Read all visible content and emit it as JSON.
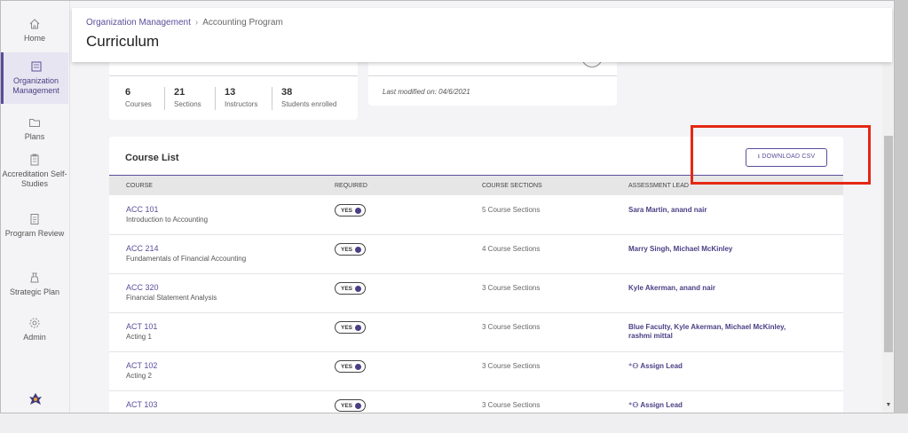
{
  "sidebar": {
    "items": [
      {
        "label": "Home",
        "icon": "home-icon"
      },
      {
        "label": "Organization Management",
        "icon": "organization-icon"
      },
      {
        "label": "Plans",
        "icon": "folder-icon"
      },
      {
        "label": "Accreditation Self-Studies",
        "icon": "clipboard-icon"
      },
      {
        "label": "Program Review",
        "icon": "document-icon"
      },
      {
        "label": "Strategic Plan",
        "icon": "chess-icon"
      },
      {
        "label": "Admin",
        "icon": "gear-icon"
      }
    ],
    "active": "Organization Management"
  },
  "header": {
    "breadcrumb": [
      "Organization Management",
      "Accounting Program"
    ],
    "title": "Curriculum"
  },
  "stats": [
    {
      "value": "6",
      "label": "Courses"
    },
    {
      "value": "21",
      "label": "Sections"
    },
    {
      "value": "13",
      "label": "Instructors"
    },
    {
      "value": "38",
      "label": "Students enrolled"
    }
  ],
  "modified": {
    "text": "Last modified on: 04/6/2021"
  },
  "course_list": {
    "title": "Course List",
    "download_label": "DOWNLOAD CSV",
    "columns": [
      "COURSE",
      "REQUIRED",
      "COURSE SECTIONS",
      "ASSESSMENT LEAD"
    ],
    "rows": [
      {
        "code": "ACC 101",
        "name": "Introduction to Accounting",
        "required": "YES",
        "sections": "5 Course Sections",
        "lead": "Sara Martin, anand nair"
      },
      {
        "code": "ACC 214",
        "name": "Fundamentals of Financial Accounting",
        "required": "YES",
        "sections": "4 Course Sections",
        "lead": "Marry Singh, Michael McKinley"
      },
      {
        "code": "ACC 320",
        "name": "Financial Statement Analysis",
        "required": "YES",
        "sections": "3 Course Sections",
        "lead": "Kyle Akerman, anand nair"
      },
      {
        "code": "ACT 101",
        "name": "Acting 1",
        "required": "YES",
        "sections": "3 Course Sections",
        "lead": "Blue Faculty, Kyle Akerman, Michael McKinley, rashmi mittal"
      },
      {
        "code": "ACT 102",
        "name": "Acting 2",
        "required": "YES",
        "sections": "3 Course Sections",
        "lead": "Assign Lead"
      },
      {
        "code": "ACT 103",
        "name": "",
        "required": "YES",
        "sections": "3 Course Sections",
        "lead": "Assign Lead"
      }
    ]
  },
  "colors": {
    "accent": "#5a4d9a",
    "highlight": "#e52814"
  }
}
